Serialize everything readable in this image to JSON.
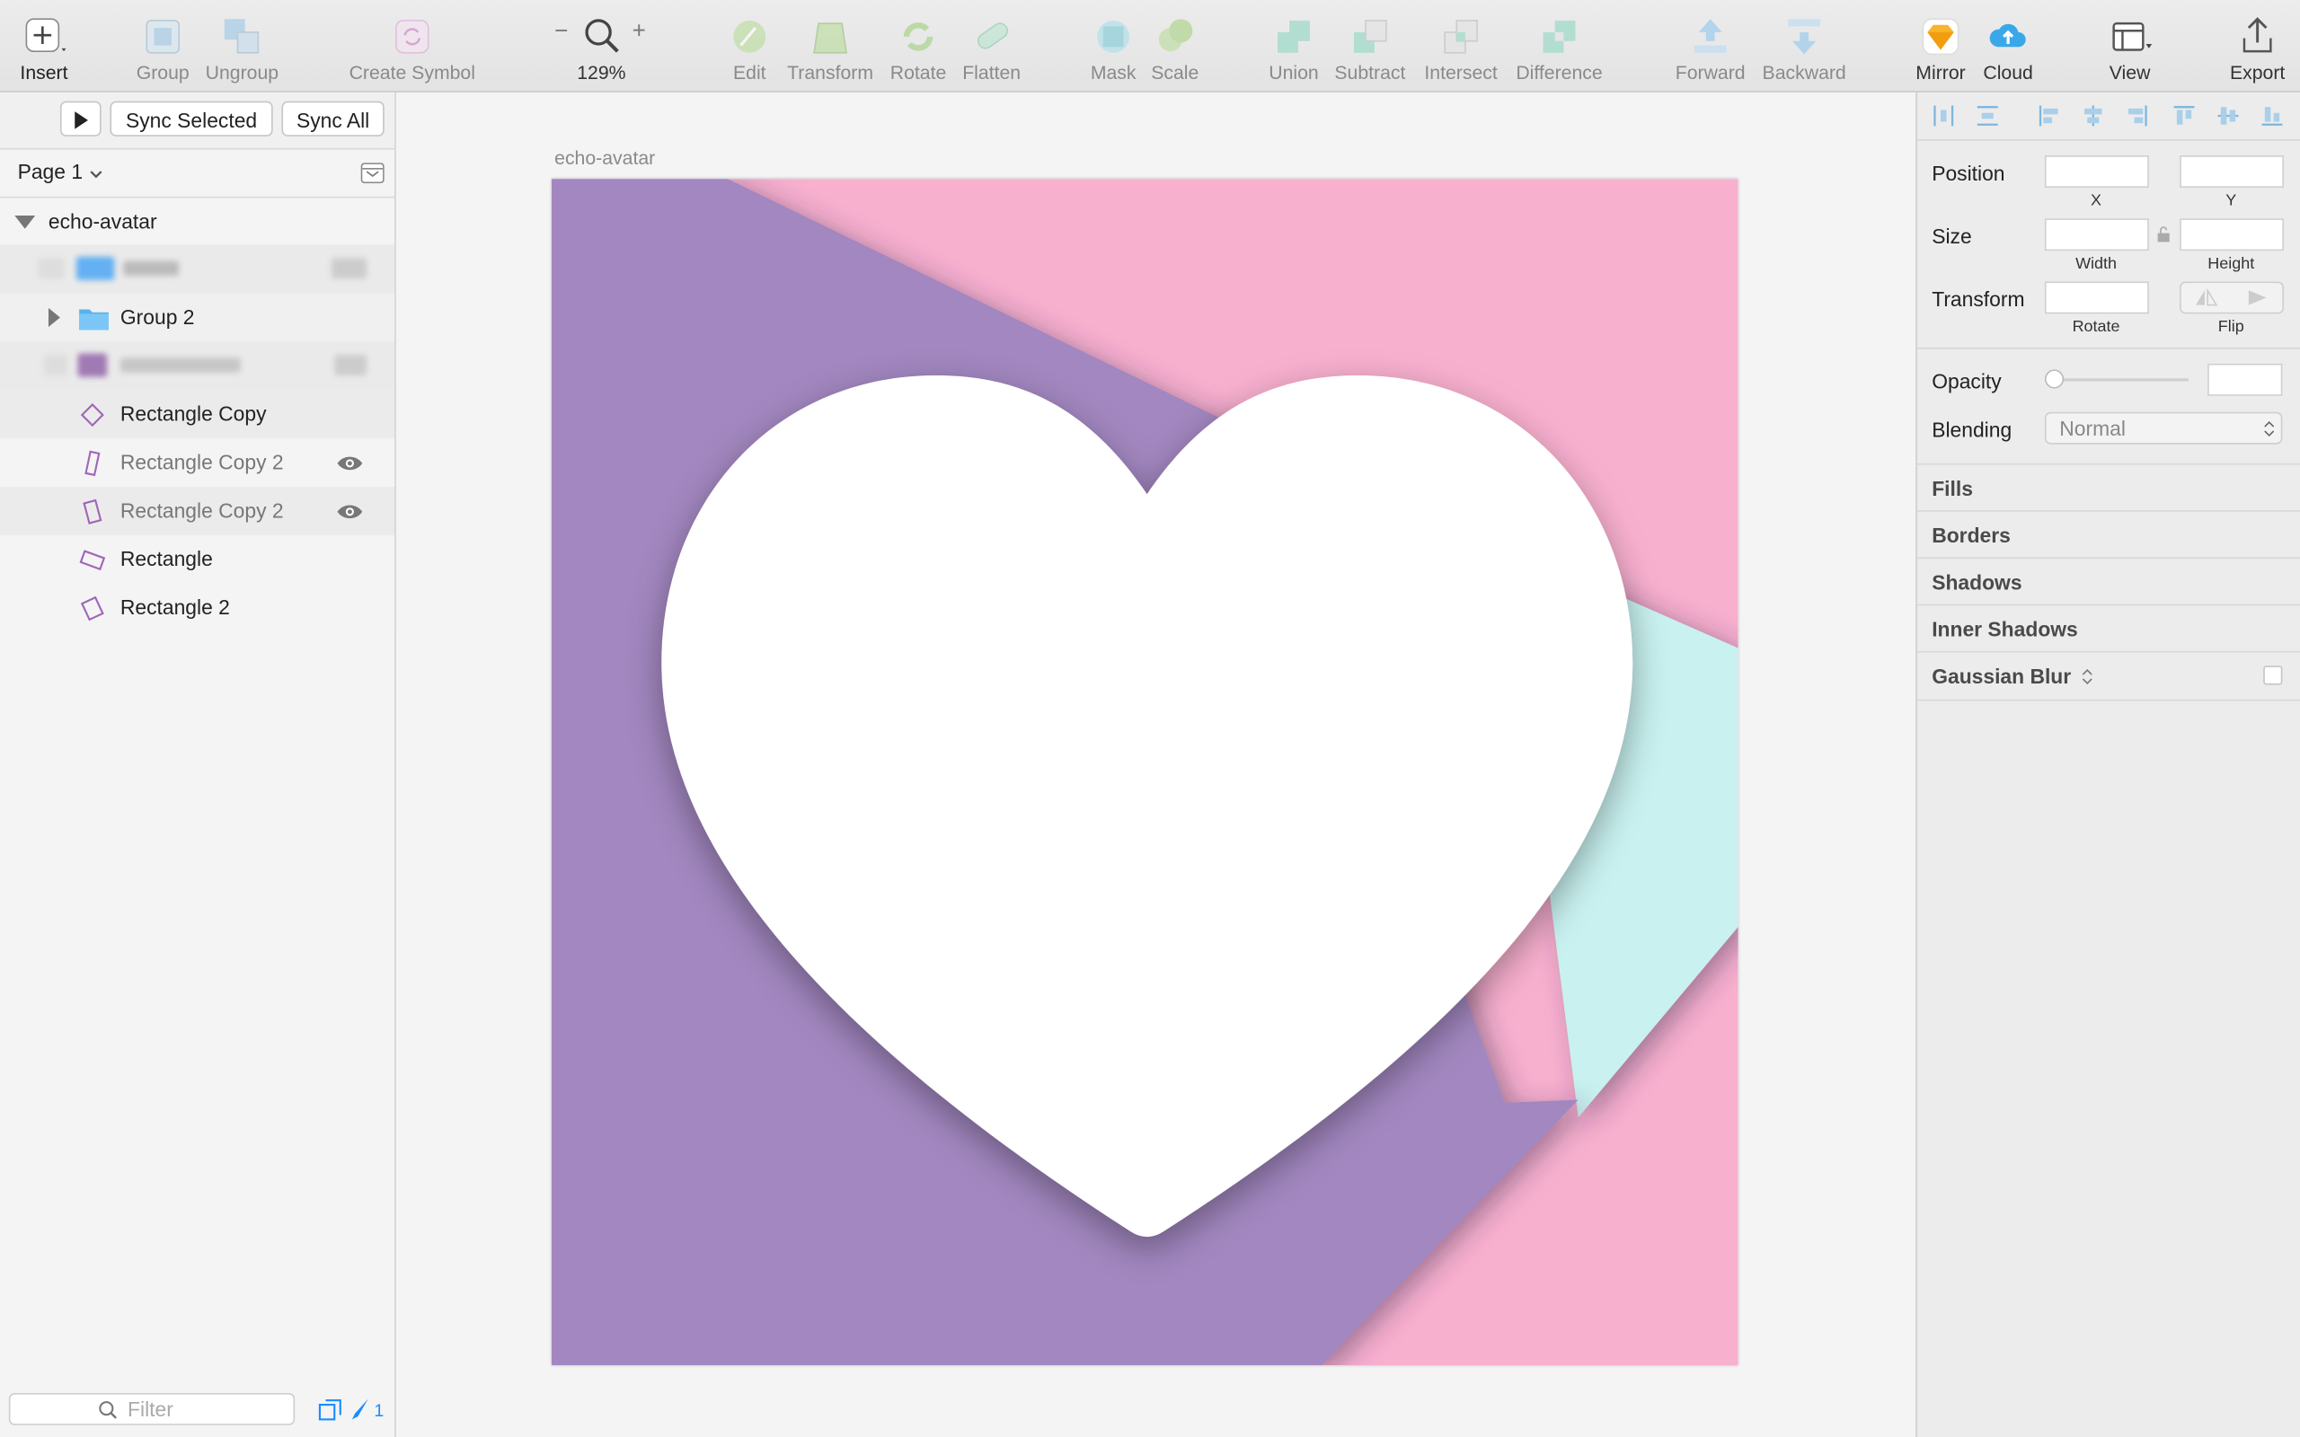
{
  "toolbar": {
    "insert": "Insert",
    "group": "Group",
    "ungroup": "Ungroup",
    "create_symbol": "Create Symbol",
    "zoom": "129%",
    "edit": "Edit",
    "transform": "Transform",
    "rotate": "Rotate",
    "flatten": "Flatten",
    "mask": "Mask",
    "scale": "Scale",
    "union": "Union",
    "subtract": "Subtract",
    "intersect": "Intersect",
    "difference": "Difference",
    "forward": "Forward",
    "backward": "Backward",
    "mirror": "Mirror",
    "cloud": "Cloud",
    "view": "View",
    "export": "Export"
  },
  "sync": {
    "selected": "Sync Selected",
    "all": "Sync All"
  },
  "page": {
    "name": "Page 1"
  },
  "layers": {
    "artboard": "echo-avatar",
    "items": [
      {
        "name": "Group 2"
      },
      {
        "name": "Rectangle Copy"
      },
      {
        "name": "Rectangle Copy 2"
      },
      {
        "name": "Rectangle Copy 2"
      },
      {
        "name": "Rectangle"
      },
      {
        "name": "Rectangle 2"
      }
    ]
  },
  "filter": {
    "placeholder": "Filter",
    "count": "1"
  },
  "canvas": {
    "artboard_label": "echo-avatar"
  },
  "inspector": {
    "position": "Position",
    "x": "X",
    "y": "Y",
    "size": "Size",
    "width": "Width",
    "height": "Height",
    "transform": "Transform",
    "rotate": "Rotate",
    "flip": "Flip",
    "opacity": "Opacity",
    "blending": "Blending",
    "blending_value": "Normal",
    "sections": [
      "Fills",
      "Borders",
      "Shadows",
      "Inner Shadows",
      "Gaussian Blur"
    ]
  },
  "colors": {
    "purple": "#a287c0",
    "pink": "#f8b0cf",
    "mint": "#c8f1ef",
    "heart": "#ffffff",
    "accent": "#1a8cff"
  }
}
